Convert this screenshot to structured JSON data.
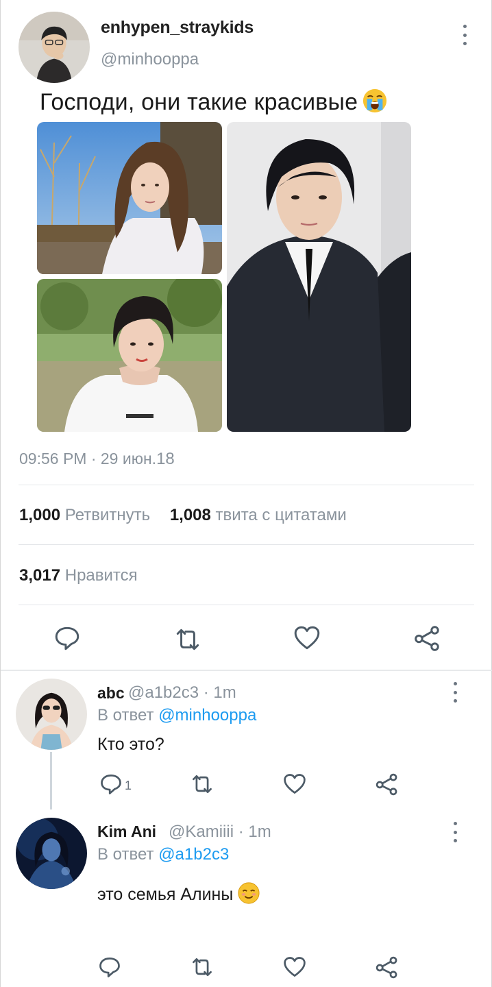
{
  "tweet": {
    "display_name": "enhypen_straykids",
    "handle": "@minhooppa",
    "text": "Господи, они такие красивые",
    "emoji": "loudly-crying-face",
    "time": "09:56 PM · 29 июн.",
    "year": "18",
    "retweets_count": "1,000",
    "retweets_label": "Ретвитнуть",
    "quotes_count": "1,008",
    "quotes_label": "твита с цитатами",
    "likes_count": "3,017",
    "likes_label": "Нравится",
    "actions": [
      "reply-icon",
      "retweet-icon",
      "like-icon",
      "share-icon"
    ]
  },
  "replies": [
    {
      "name": "abc",
      "meta": "@a1b2c3 · 1m",
      "reply_prefix": "В ответ",
      "reply_to": "@minhooppa",
      "text": "Кто это?",
      "reply_count": "1"
    },
    {
      "name": "Kim Ani",
      "meta": "@Kamiiii · 1m",
      "reply_prefix": "В ответ",
      "reply_to": "@a1b2c3",
      "text": "это семья Алины",
      "emoji": "smiling-face-with-smiling-eyes"
    }
  ],
  "colors": {
    "link": "#1d9bf0",
    "muted": "#8a939c",
    "icon": "#4c5a66"
  }
}
